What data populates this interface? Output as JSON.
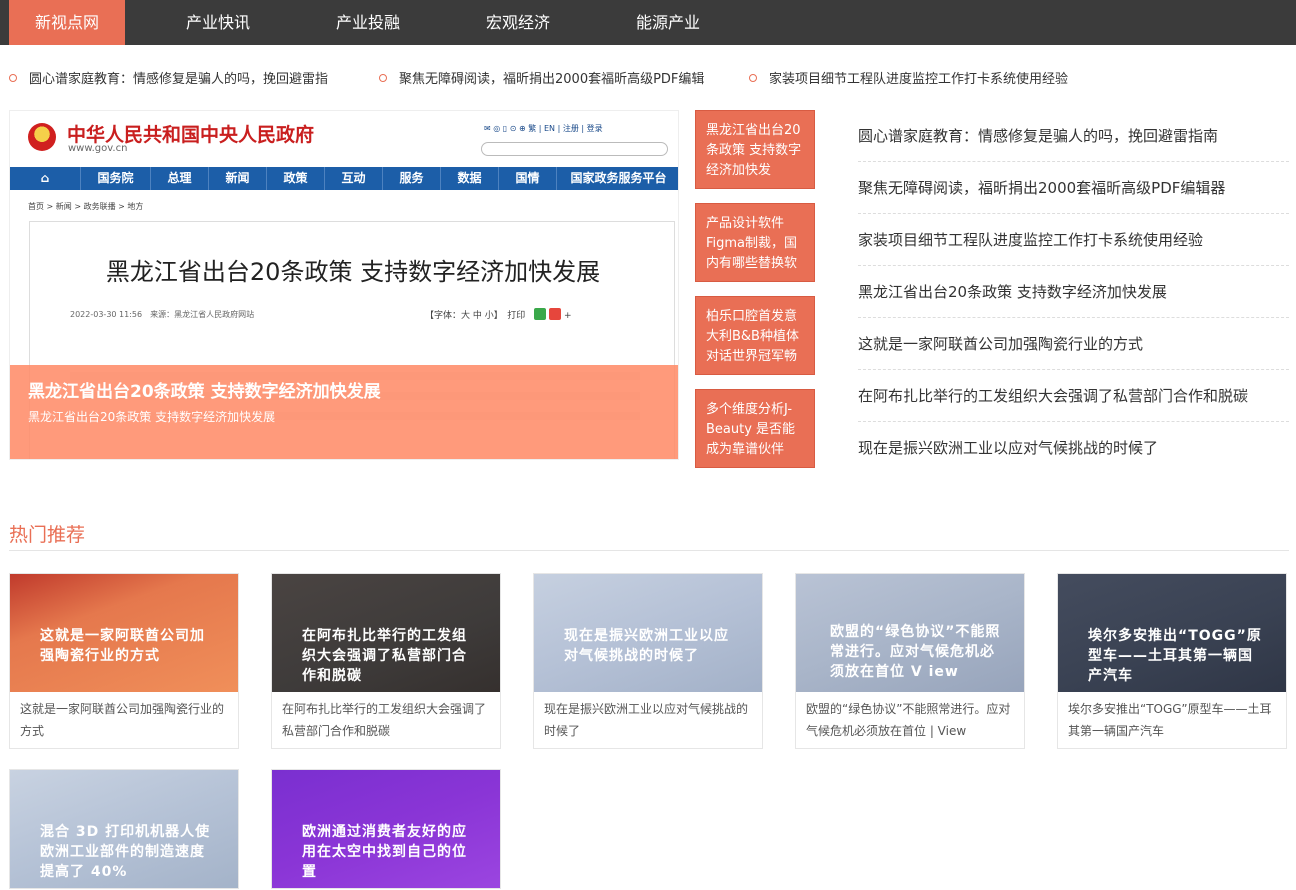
{
  "nav": {
    "items": [
      "新视点网",
      "产业快讯",
      "产业投融",
      "宏观经济",
      "能源产业"
    ],
    "active": 0
  },
  "ticker": [
    "圆心谱家庭教育：情感修复是骗人的吗，挽回避雷指",
    "聚焦无障碍阅读，福昕捐出2000套福昕高级PDF编辑",
    "家装项目细节工程队进度监控工作打卡系统使用经验"
  ],
  "hero": {
    "gov": {
      "site_title": "中华人民共和国中央人民政府",
      "url": "www.gov.cn",
      "links": "繁 | EN | 注册 | 登录",
      "menu": [
        "国务院",
        "总理",
        "新闻",
        "政策",
        "互动",
        "服务",
        "数据",
        "国情",
        "国家政务服务平台"
      ],
      "breadcrumb": "首页 > 新闻 > 政务联播 > 地方",
      "article_title": "黑龙江省出台20条政策 支持数字经济加快发展",
      "article_meta": "2022-03-30 11:56　来源：黑龙江省人民政府网站",
      "article_tools": "【字体：大 中 小】　打印"
    },
    "caption_title": "黑龙江省出台20条政策 支持数字经济加快发展",
    "caption_sub": "黑龙江省出台20条政策 支持数字经济加快发展"
  },
  "side_boxes": [
    "黑龙江省出台20条政策 支持数字经济加快发",
    "产品设计软件Figma制裁，国内有哪些替换软",
    "柏乐口腔首发意大利B&B种植体 对话世界冠军畅",
    "多个维度分析J-Beauty 是否能成为靠谱伙伴"
  ],
  "side_list": [
    "圆心谱家庭教育：情感修复是骗人的吗，挽回避雷指南",
    "聚焦无障碍阅读，福昕捐出2000套福昕高级PDF编辑器",
    "家装项目细节工程队进度监控工作打卡系统使用经验",
    "黑龙江省出台20条政策 支持数字经济加快发展",
    "这就是一家阿联酋公司加强陶瓷行业的方式",
    "在阿布扎比举行的工发组织大会强调了私营部门合作和脱碳",
    "现在是振兴欧洲工业以应对气候挑战的时候了"
  ],
  "hot": {
    "title": "热门推荐",
    "cards": [
      {
        "thumb_text": "这就是一家阿联酋公司加强陶瓷行业的方式",
        "caption": "这就是一家阿联酋公司加强陶瓷行业的方式",
        "bg": "#e5784d"
      },
      {
        "thumb_text": "在阿布扎比举行的工发组织大会强调了私营部门合作和脱碳",
        "caption": "在阿布扎比举行的工发组织大会强调了私营部门合作和脱碳",
        "bg": "#3e3b3a"
      },
      {
        "thumb_text": "现在是振兴欧洲工业以应对气候挑战的时候了",
        "caption": "现在是振兴欧洲工业以应对气候挑战的时候了",
        "bg": "#b5c1d6"
      },
      {
        "thumb_text": "欧盟的“绿色协议”不能照常进行。应对气候危机必须放在首位 V iew",
        "caption": "欧盟的“绿色协议”不能照常进行。应对气候危机必须放在首位 | View",
        "bg": "#a9b5c9"
      },
      {
        "thumb_text": "埃尔多安推出“TOGG”原型车——土耳其第一辆国产汽车",
        "caption": "埃尔多安推出“TOGG”原型车——土耳其第一辆国产汽车",
        "bg": "#3a4253"
      },
      {
        "thumb_text": "混合 3D 打印机机器人使欧洲工业部件的制造速度提高了 40%",
        "caption": "",
        "bg": "#b5c2d6"
      },
      {
        "thumb_text": "欧洲通过消费者友好的应用在太空中找到自己的位置",
        "caption": "",
        "bg": "#8a35d6"
      }
    ]
  }
}
